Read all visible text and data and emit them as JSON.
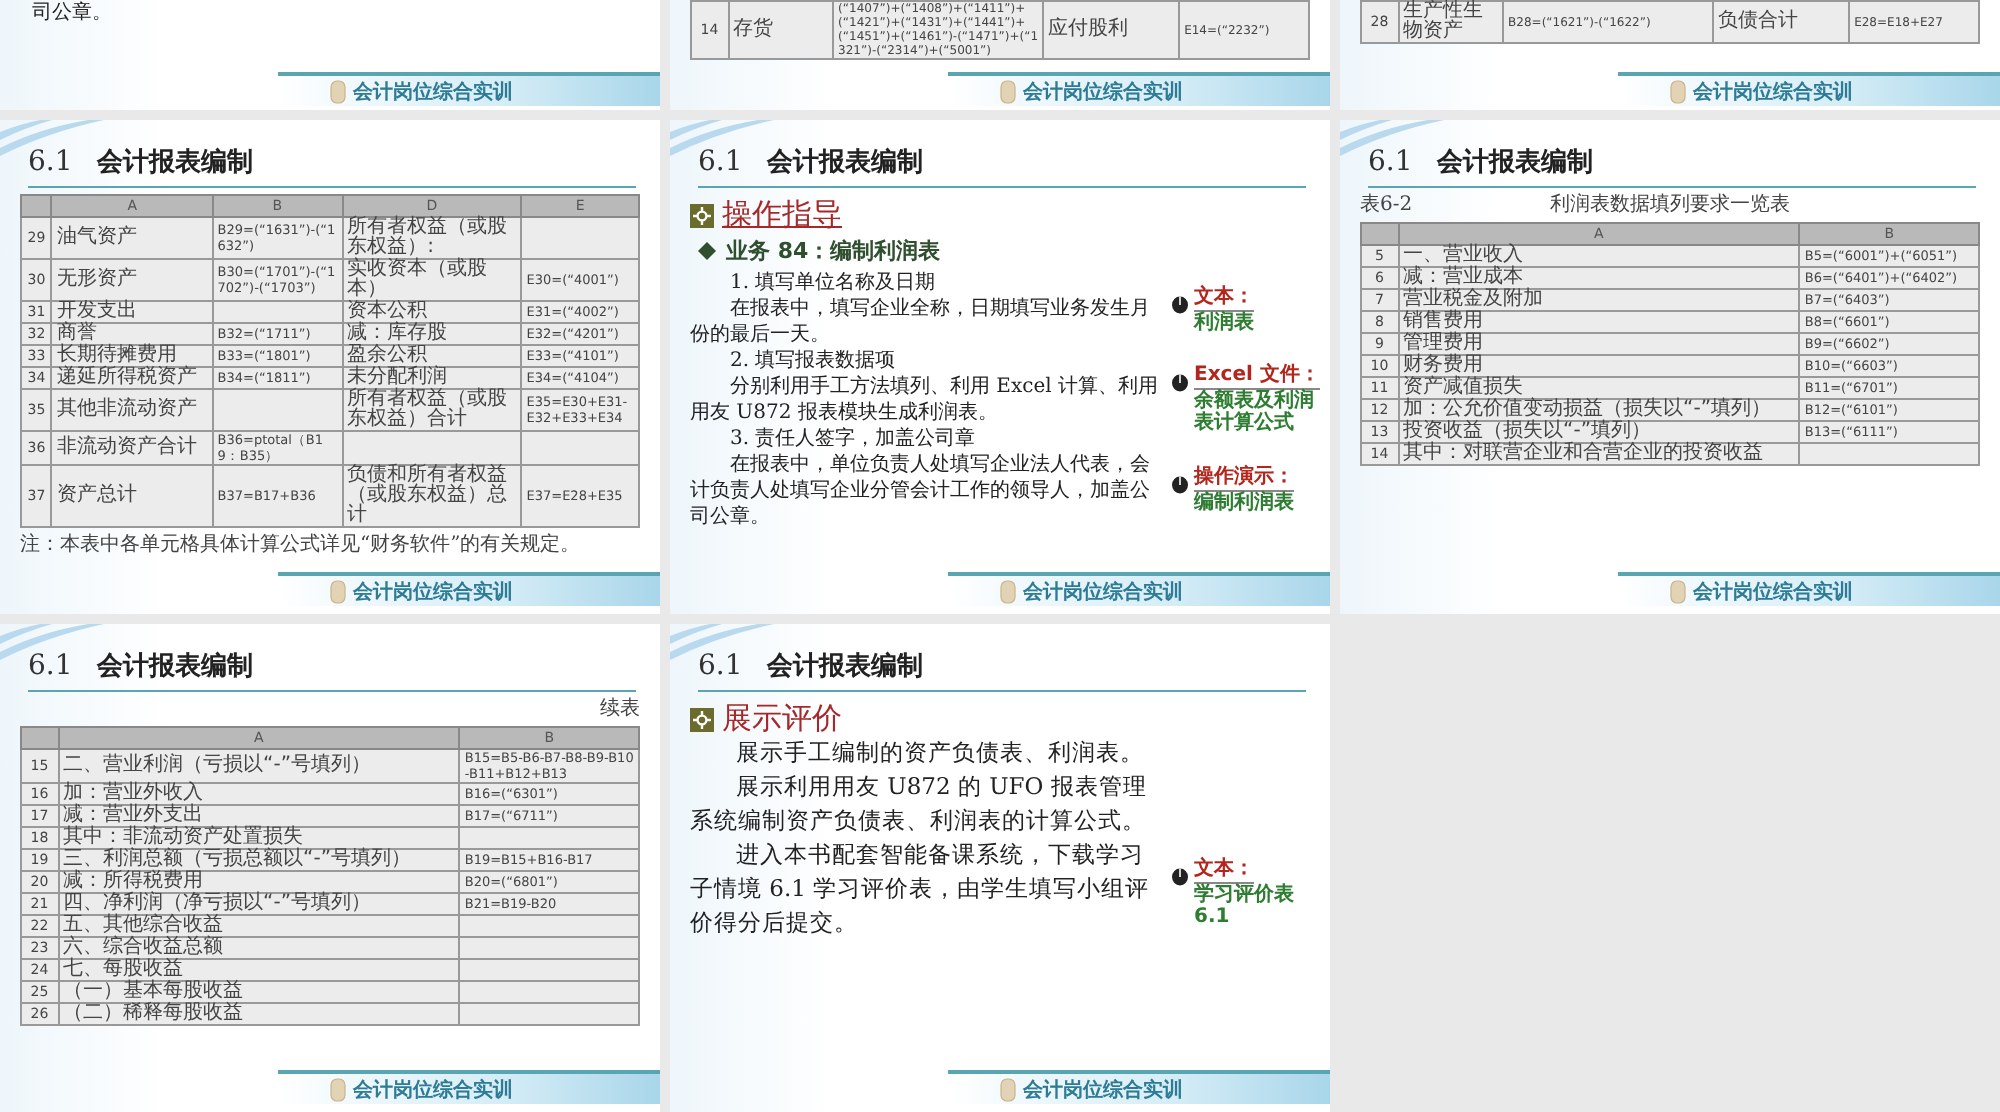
{
  "slides": [
    {
      "kind": "text-tail",
      "lines": [
        "司公章。"
      ],
      "footer": "会计岗位综合实训"
    },
    {
      "kind": "table-tail",
      "rows": [
        {
          "cells": [
            "14",
            "存货",
            "(“1407”)+(“1408”)+(“1411”)+(“1421”)+(“1431”)+(“1441”)+(“1451”)+(“1461”)-(“1471”)+(“1321”)-(“2314”)+(“5001”)",
            "应付股利",
            "E14=(“2232”)"
          ]
        }
      ],
      "footer": "会计岗位综合实训"
    },
    {
      "kind": "table-tail",
      "rows": [
        {
          "cells": [
            "28",
            "生产性生物资产",
            "B28=(“1621”)-(“1622”)",
            "负债合计",
            "E28=E18+E27"
          ]
        }
      ],
      "footer": "会计岗位综合实训"
    },
    {
      "kind": "table",
      "section": "6.1",
      "heading": "会计报表编制",
      "columns": [
        "",
        "A",
        "B",
        "D",
        "E"
      ],
      "rows": [
        {
          "cells": [
            "29",
            "油气资产",
            "B29=(“1631”)-(“1632”)",
            "所有者权益（或股东权益）:",
            null
          ]
        },
        {
          "cells": [
            "30",
            "无形资产",
            "B30=(“1701”)-(“1702”)-(“1703”)",
            "实收资本（或股本）",
            "E30=(“4001”)"
          ]
        },
        {
          "cells": [
            "31",
            "开发支出",
            null,
            "资本公积",
            "E31=(“4002”)"
          ]
        },
        {
          "cells": [
            "32",
            "商誉",
            "B32=(“1711”)",
            "减：库存股",
            "E32=(“4201”)"
          ]
        },
        {
          "cells": [
            "33",
            "长期待摊费用",
            "B33=(“1801”)",
            "盈余公积",
            "E33=(“4101”)"
          ]
        },
        {
          "cells": [
            "34",
            "递延所得税资产",
            "B34=(“1811”)",
            "未分配利润",
            "E34=(“4104”)"
          ]
        },
        {
          "cells": [
            "35",
            "其他非流动资产",
            null,
            "所有者权益（或股东权益）合计",
            "E35=E30+E31-E32+E33+E34"
          ]
        },
        {
          "cells": [
            "36",
            "非流动资产合计",
            "B36=ptotal（B19：B35）",
            null,
            null
          ]
        },
        {
          "cells": [
            "37",
            "资产总计",
            "B37=B17+B36",
            "负债和所有者权益（或股东权益）总计",
            "E37=E28+E35"
          ]
        }
      ],
      "note": "注：本表中各单元格具体计算公式详见“财务软件”的有关规定。",
      "footer": "会计岗位综合实训"
    },
    {
      "kind": "guide",
      "section": "6.1",
      "heading": "会计报表编制",
      "title": "操作指导",
      "subtitle": "业务 84：编制利润表",
      "paragraphs": [
        "1. 填写单位名称及日期",
        "在报表中，填写企业全称，日期填写业务发生月份的最后一天。",
        "2. 填写报表数据项",
        "分别利用手工方法填列、利用 Excel 计算、利用用友 U872 报表模块生成利润表。",
        "3. 责任人签字，加盖公司章",
        "在报表中，单位负责人处填写企业法人代表，会计负责人处填写企业分管会计工作的领导人，加盖公司公章。"
      ],
      "links": [
        {
          "label": "文本：",
          "target": "利润表"
        },
        {
          "label": "Excel 文件：",
          "target": "余额表及利润表计算公式"
        },
        {
          "label": "操作演示：",
          "target": "编制利润表"
        }
      ],
      "footer": "会计岗位综合实训"
    },
    {
      "kind": "table",
      "section": "6.1",
      "heading": "会计报表编制",
      "caption_left": "表6-2",
      "caption_center": "利润表数据填列要求一览表",
      "columns": [
        "",
        "A",
        "B"
      ],
      "rows": [
        {
          "cells": [
            "5",
            "一、营业收入",
            "B5=(“6001”)+(“6051”)"
          ]
        },
        {
          "cells": [
            "6",
            "减：营业成本",
            "B6=(“6401”)+(“6402”)"
          ]
        },
        {
          "cells": [
            "7",
            "营业税金及附加",
            "B7=(“6403”)"
          ]
        },
        {
          "cells": [
            "8",
            "销售费用",
            "B8=(“6601”)"
          ]
        },
        {
          "cells": [
            "9",
            "管理费用",
            "B9=(“6602”)"
          ]
        },
        {
          "cells": [
            "10",
            "财务费用",
            "B10=(“6603”)"
          ]
        },
        {
          "cells": [
            "11",
            "资产减值损失",
            "B11=(“6701”)"
          ]
        },
        {
          "cells": [
            "12",
            "加：公允价值变动损益（损失以“-”填列）",
            "B12=(“6101”)"
          ]
        },
        {
          "cells": [
            "13",
            "投资收益（损失以“-”填列）",
            "B13=(“6111”)"
          ]
        },
        {
          "cells": [
            "14",
            "其中：对联营企业和合营企业的投资收益",
            null
          ]
        }
      ],
      "footer": "会计岗位综合实训"
    },
    {
      "kind": "table",
      "section": "6.1",
      "heading": "会计报表编制",
      "caption_right": "续表",
      "columns": [
        "",
        "A",
        "B"
      ],
      "rows": [
        {
          "cells": [
            "15",
            "二、营业利润（亏损以“-”号填列）",
            "B15=B5-B6-B7-B8-B9-B10-B11+B12+B13"
          ]
        },
        {
          "cells": [
            "16",
            "加：营业外收入",
            "B16=(“6301”)"
          ]
        },
        {
          "cells": [
            "17",
            "减：营业外支出",
            "B17=(“6711”)"
          ]
        },
        {
          "cells": [
            "18",
            "其中：非流动资产处置损失",
            null
          ]
        },
        {
          "cells": [
            "19",
            "三、利润总额（亏损总额以“-”号填列）",
            "B19=B15+B16-B17"
          ]
        },
        {
          "cells": [
            "20",
            "减：所得税费用",
            "B20=(“6801”)"
          ]
        },
        {
          "cells": [
            "21",
            "四、净利润（净亏损以“-”号填列）",
            "B21=B19-B20"
          ]
        },
        {
          "cells": [
            "22",
            "五、其他综合收益",
            null
          ]
        },
        {
          "cells": [
            "23",
            "六、综合收益总额",
            null
          ]
        },
        {
          "cells": [
            "24",
            "七、每股收益",
            null
          ]
        },
        {
          "cells": [
            "25",
            "（一）基本每股收益",
            null
          ]
        },
        {
          "cells": [
            "26",
            "（二）稀释每股收益",
            null
          ]
        }
      ],
      "footer": "会计岗位综合实训"
    },
    {
      "kind": "evaluation",
      "section": "6.1",
      "heading": "会计报表编制",
      "title": "展示评价",
      "paragraphs": [
        "展示手工编制的资产负债表、利润表。",
        "展示利用用友 U872 的 UFO 报表管理系统编制资产负债表、利润表的计算公式。",
        "进入本书配套智能备课系统，下载学习子情境 6.1 学习评价表，由学生填写小组评价得分后提交。"
      ],
      "links": [
        {
          "label": "文本：",
          "target": "学习评价表6.1"
        }
      ],
      "footer": "会计岗位综合实训"
    }
  ]
}
